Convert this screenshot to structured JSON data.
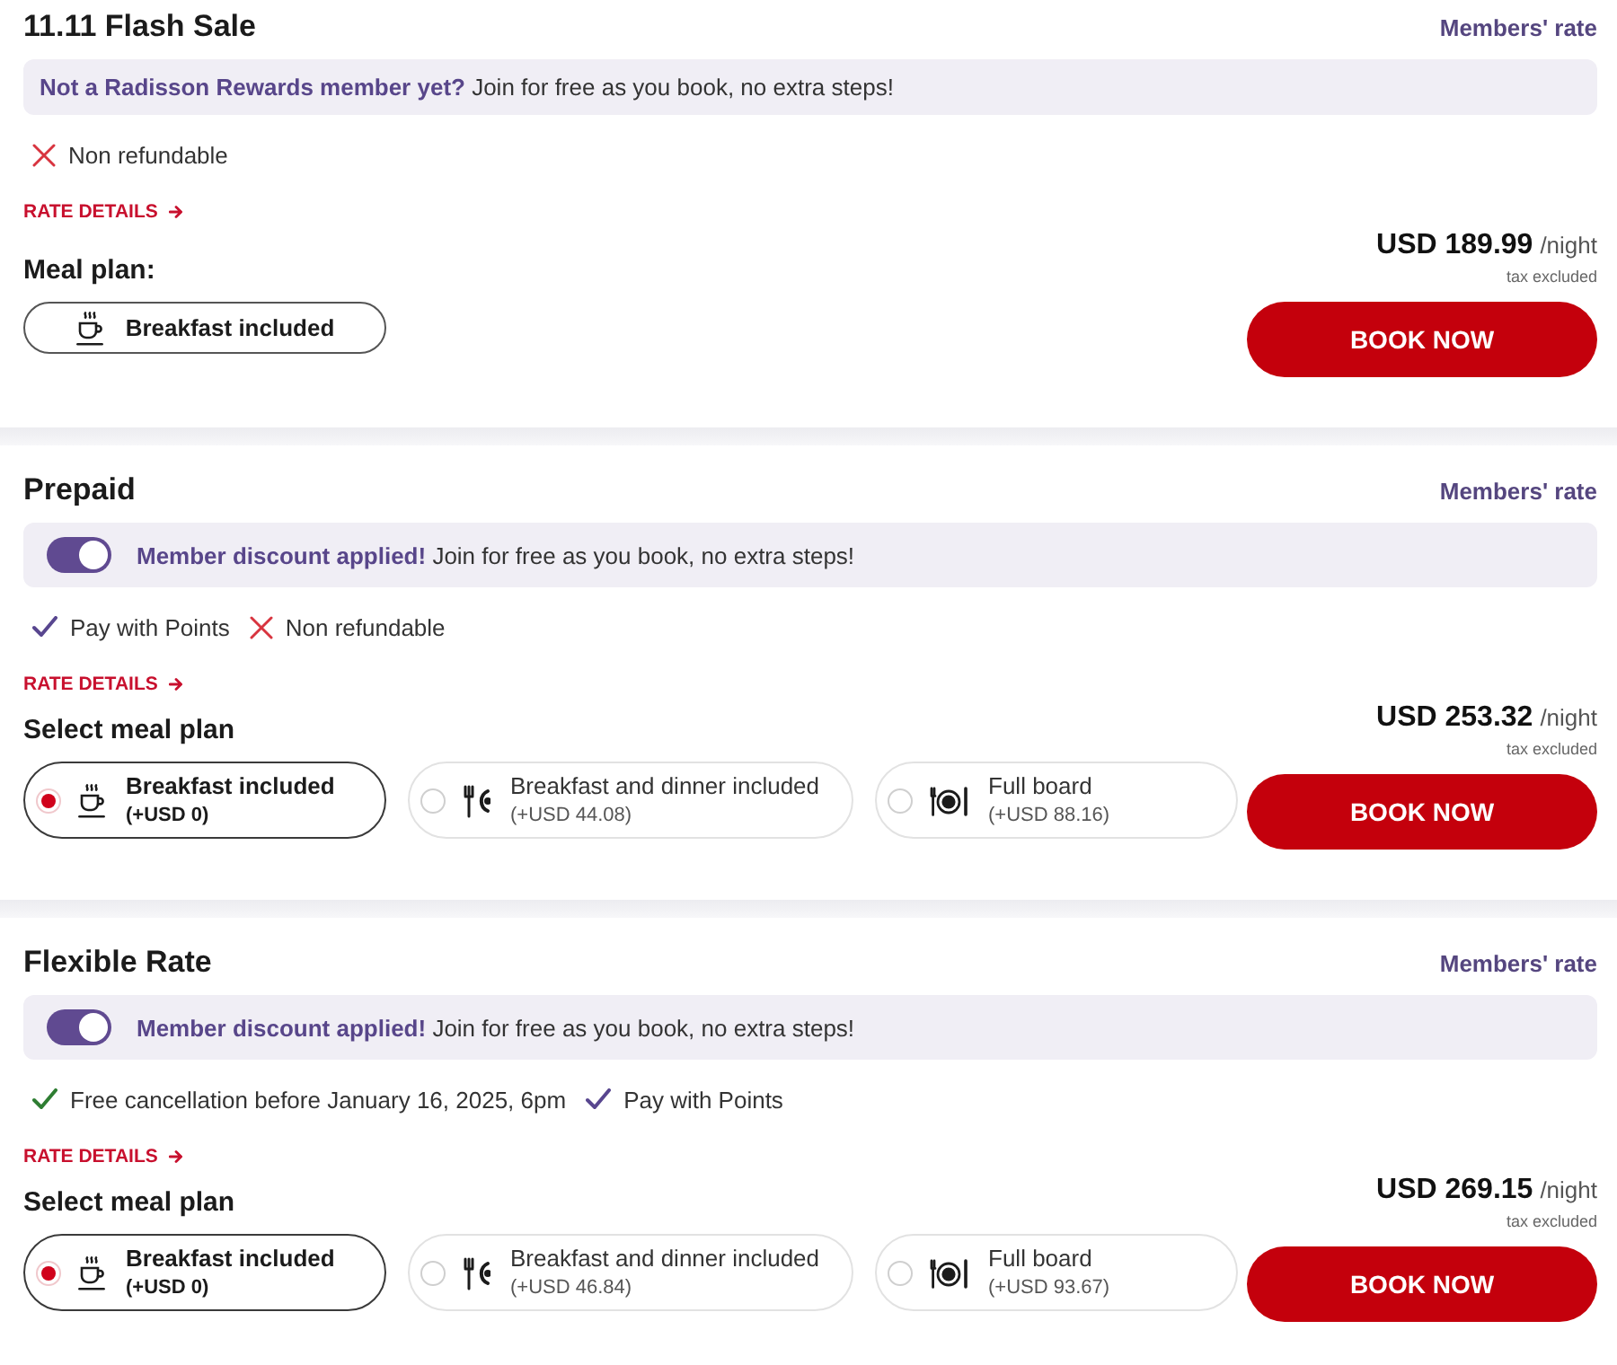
{
  "rates": [
    {
      "title": "11.11 Flash Sale",
      "badge": "Members' rate",
      "banner": {
        "text": "**Not a Radisson Rewards member yet?** Join for free as you book, no extra steps!"
      },
      "features": [
        {
          "kind": "cross",
          "color": "#d8343f",
          "text": "Non refundable"
        }
      ],
      "details_link": "RATE DETAILS",
      "meal_plan": {
        "kind": "fixed",
        "label": "Meal plan:",
        "options": [
          {
            "kind": "breakfast",
            "label": "Breakfast included"
          }
        ]
      },
      "price": {
        "amount": "USD 189.99",
        "unit": "/night",
        "note": "tax excluded"
      },
      "button": "BOOK NOW"
    },
    {
      "title": "Prepaid",
      "badge": "Members' rate",
      "banner": {
        "toggle": {
          "on": true
        },
        "text": "**Member discount applied!** Join for free as you book, no extra steps!"
      },
      "features": [
        {
          "kind": "check",
          "color": "#58468f",
          "text": "Pay with Points"
        },
        {
          "kind": "cross",
          "color": "#d8343f",
          "text": "Non refundable"
        }
      ],
      "details_link": "RATE DETAILS",
      "meal_plan": {
        "kind": "select",
        "label": "Select meal plan",
        "options": [
          {
            "kind": "breakfast",
            "label": "Breakfast included",
            "price": "(+USD 0)",
            "selected": true
          },
          {
            "kind": "half_board",
            "label": "Breakfast and dinner included",
            "price": "(+USD 44.08)",
            "selected": false
          },
          {
            "kind": "full_board",
            "label": "Full board",
            "price": "(+USD 88.16)",
            "selected": false
          }
        ]
      },
      "price": {
        "amount": "USD 253.32",
        "unit": "/night",
        "note": "tax excluded"
      },
      "button": "BOOK NOW"
    },
    {
      "title": "Flexible Rate",
      "badge": "Members' rate",
      "banner": {
        "toggle": {
          "on": true
        },
        "text": "**Member discount applied!** Join for free as you book, no extra steps!"
      },
      "features": [
        {
          "kind": "check",
          "color": "#2e7d32",
          "text": "Free cancellation before January 16, 2025, 6pm"
        },
        {
          "kind": "check",
          "color": "#58468f",
          "text": "Pay with Points"
        }
      ],
      "details_link": "RATE DETAILS",
      "meal_plan": {
        "kind": "select",
        "label": "Select meal plan",
        "options": [
          {
            "kind": "breakfast",
            "label": "Breakfast included",
            "price": "(+USD 0)",
            "selected": true
          },
          {
            "kind": "half_board",
            "label": "Breakfast and dinner included",
            "price": "(+USD 46.84)",
            "selected": false
          },
          {
            "kind": "full_board",
            "label": "Full board",
            "price": "(+USD 93.67)",
            "selected": false
          }
        ]
      },
      "price": {
        "amount": "USD 269.15",
        "unit": "/night",
        "note": "tax excluded"
      },
      "button": "BOOK NOW"
    }
  ]
}
